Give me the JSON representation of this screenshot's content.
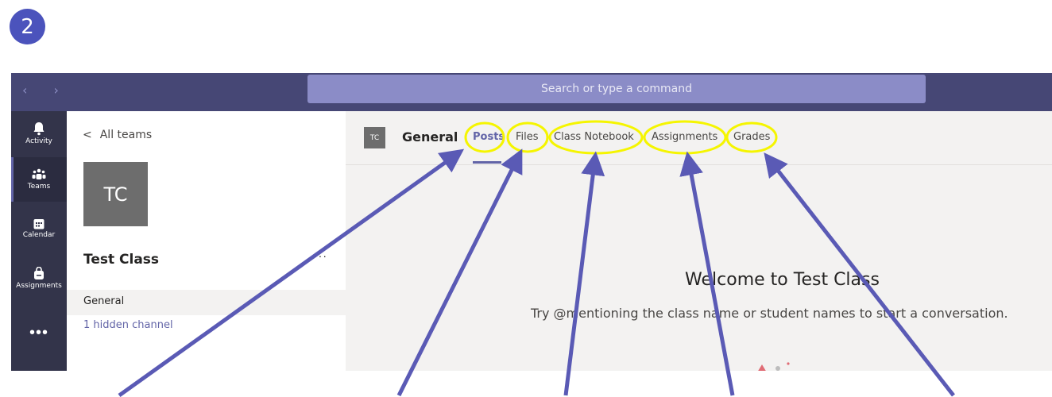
{
  "step_number": "2",
  "titlebar": {
    "nav_arrows": "‹  ›",
    "search_placeholder": "Search or type a command"
  },
  "rail": {
    "items": [
      {
        "label": "Activity",
        "icon": "bell-icon"
      },
      {
        "label": "Teams",
        "icon": "teams-icon"
      },
      {
        "label": "Calendar",
        "icon": "calendar-icon"
      },
      {
        "label": "Assignments",
        "icon": "bag-icon"
      }
    ],
    "more": "•••"
  },
  "teams_panel": {
    "back_label": "All teams",
    "team_initials": "TC",
    "team_name": "Test Class",
    "more": "···",
    "channels": [
      "General"
    ],
    "hidden_channel": "1 hidden channel"
  },
  "main": {
    "channel_initials": "TC",
    "channel_title": "General",
    "tabs": [
      "Posts",
      "Files",
      "Class Notebook",
      "Assignments",
      "Grades"
    ],
    "active_tab": "Posts",
    "welcome_title": "Welcome to Test Class",
    "welcome_subtitle": "Try @mentioning the class name or student names to start a conversation."
  },
  "colors": {
    "accent": "#6264a7",
    "titlebar": "#464775",
    "rail": "#33344a",
    "highlight": "#f5f500",
    "arrow": "#5a5ab5",
    "badge": "#4b53bc"
  }
}
